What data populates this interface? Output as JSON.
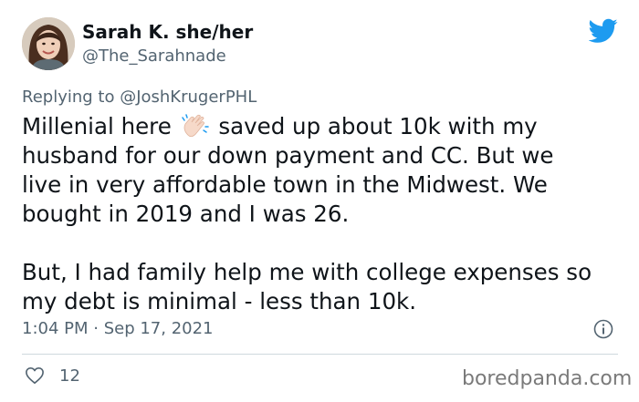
{
  "author": {
    "name": "Sarah K. she/her",
    "handle": "@The_Sarahnade"
  },
  "reply": {
    "prefix": "Replying to ",
    "mention": "@JoshKrugerPHL"
  },
  "tweet": {
    "text_before_emoji": "Millenial here ",
    "emoji": "clapping-hands-light-skin",
    "text_after_emoji": " saved up about 10k with my\nhusband for our down payment and CC. But we\nlive in very affordable town in the Midwest. We\nbought in 2019 and I was 26.\n\nBut, I had family help me with college expenses so\nmy debt is minimal - less than 10k."
  },
  "timestamp": "1:04 PM · Sep 17, 2021",
  "likes_count": "12",
  "watermark": "boredpanda.com",
  "icons": {
    "brand": "twitter-bird-icon",
    "info": "info-icon",
    "like": "heart-icon"
  },
  "colors": {
    "twitter_blue": "#1d9bf0",
    "muted_text": "#536471",
    "divider": "#cfd9de"
  }
}
